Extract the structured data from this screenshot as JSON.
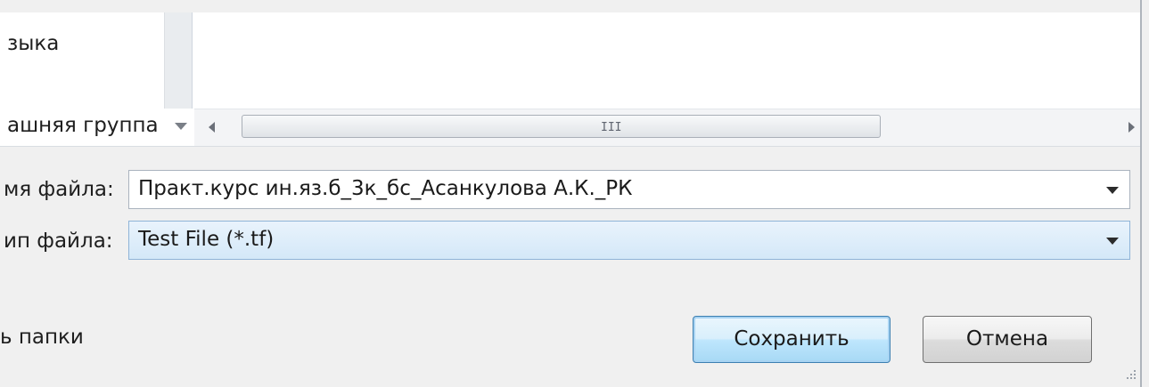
{
  "nav": {
    "items": [
      {
        "label": "зыка"
      }
    ],
    "group_label": "ашняя группа"
  },
  "file_name": {
    "label": "мя файла:",
    "value": "Практ.курс ин.яз.б_3к_бс_Асанкулова А.К._РК"
  },
  "file_type": {
    "label": "ип файла:",
    "value": "Test File (*.tf)"
  },
  "hscroll": {
    "grip": "III"
  },
  "footer": {
    "hide_folders_label": "ь папки"
  },
  "buttons": {
    "save": "Сохранить",
    "cancel": "Отмена"
  },
  "colors": {
    "dialog_bg": "#f0f0f0",
    "primary_button_border": "#3c7fb1",
    "filetype_highlight": "#d4e8f8"
  }
}
